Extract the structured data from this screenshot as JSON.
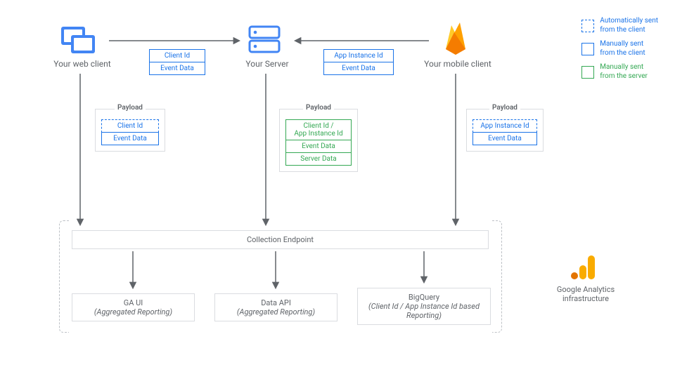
{
  "nodes": {
    "web": "Your web client",
    "server": "Your Server",
    "mobile": "Your mobile client"
  },
  "topChips": {
    "webToServer": [
      "Client Id",
      "Event Data"
    ],
    "mobileToServer": [
      "App Instance Id",
      "Event Data"
    ]
  },
  "payloadLabel": "Payload",
  "payloads": {
    "web": [
      {
        "text": "Client Id",
        "style": "blue-dashed"
      },
      {
        "text": "Event Data",
        "style": "blue-solid"
      }
    ],
    "server": [
      {
        "text": "Client Id /\nApp Instance Id",
        "style": "green-solid"
      },
      {
        "text": "Event Data",
        "style": "green-solid"
      },
      {
        "text": "Server Data",
        "style": "green-solid"
      }
    ],
    "mobile": [
      {
        "text": "App Instance Id",
        "style": "blue-dashed"
      },
      {
        "text": "Event Data",
        "style": "blue-solid"
      }
    ]
  },
  "collection": "Collection Endpoint",
  "sinks": {
    "ga": {
      "title": "GA UI",
      "sub": "(Aggregated Reporting)"
    },
    "api": {
      "title": "Data API",
      "sub": "(Aggregated Reporting)"
    },
    "bq": {
      "title": "BigQuery",
      "sub": "(Client Id / App Instance Id based Reporting)"
    }
  },
  "infraLabel": "Google Analytics\ninfrastructure",
  "legend": {
    "auto": "Automatically sent\nfrom the client",
    "manualC": "Manually sent\nfrom the client",
    "manualS": "Manually sent\nfrom the server"
  },
  "icons": {
    "web": "web-client-icon",
    "server": "server-icon",
    "firebase": "firebase-icon",
    "analytics": "analytics-icon"
  }
}
